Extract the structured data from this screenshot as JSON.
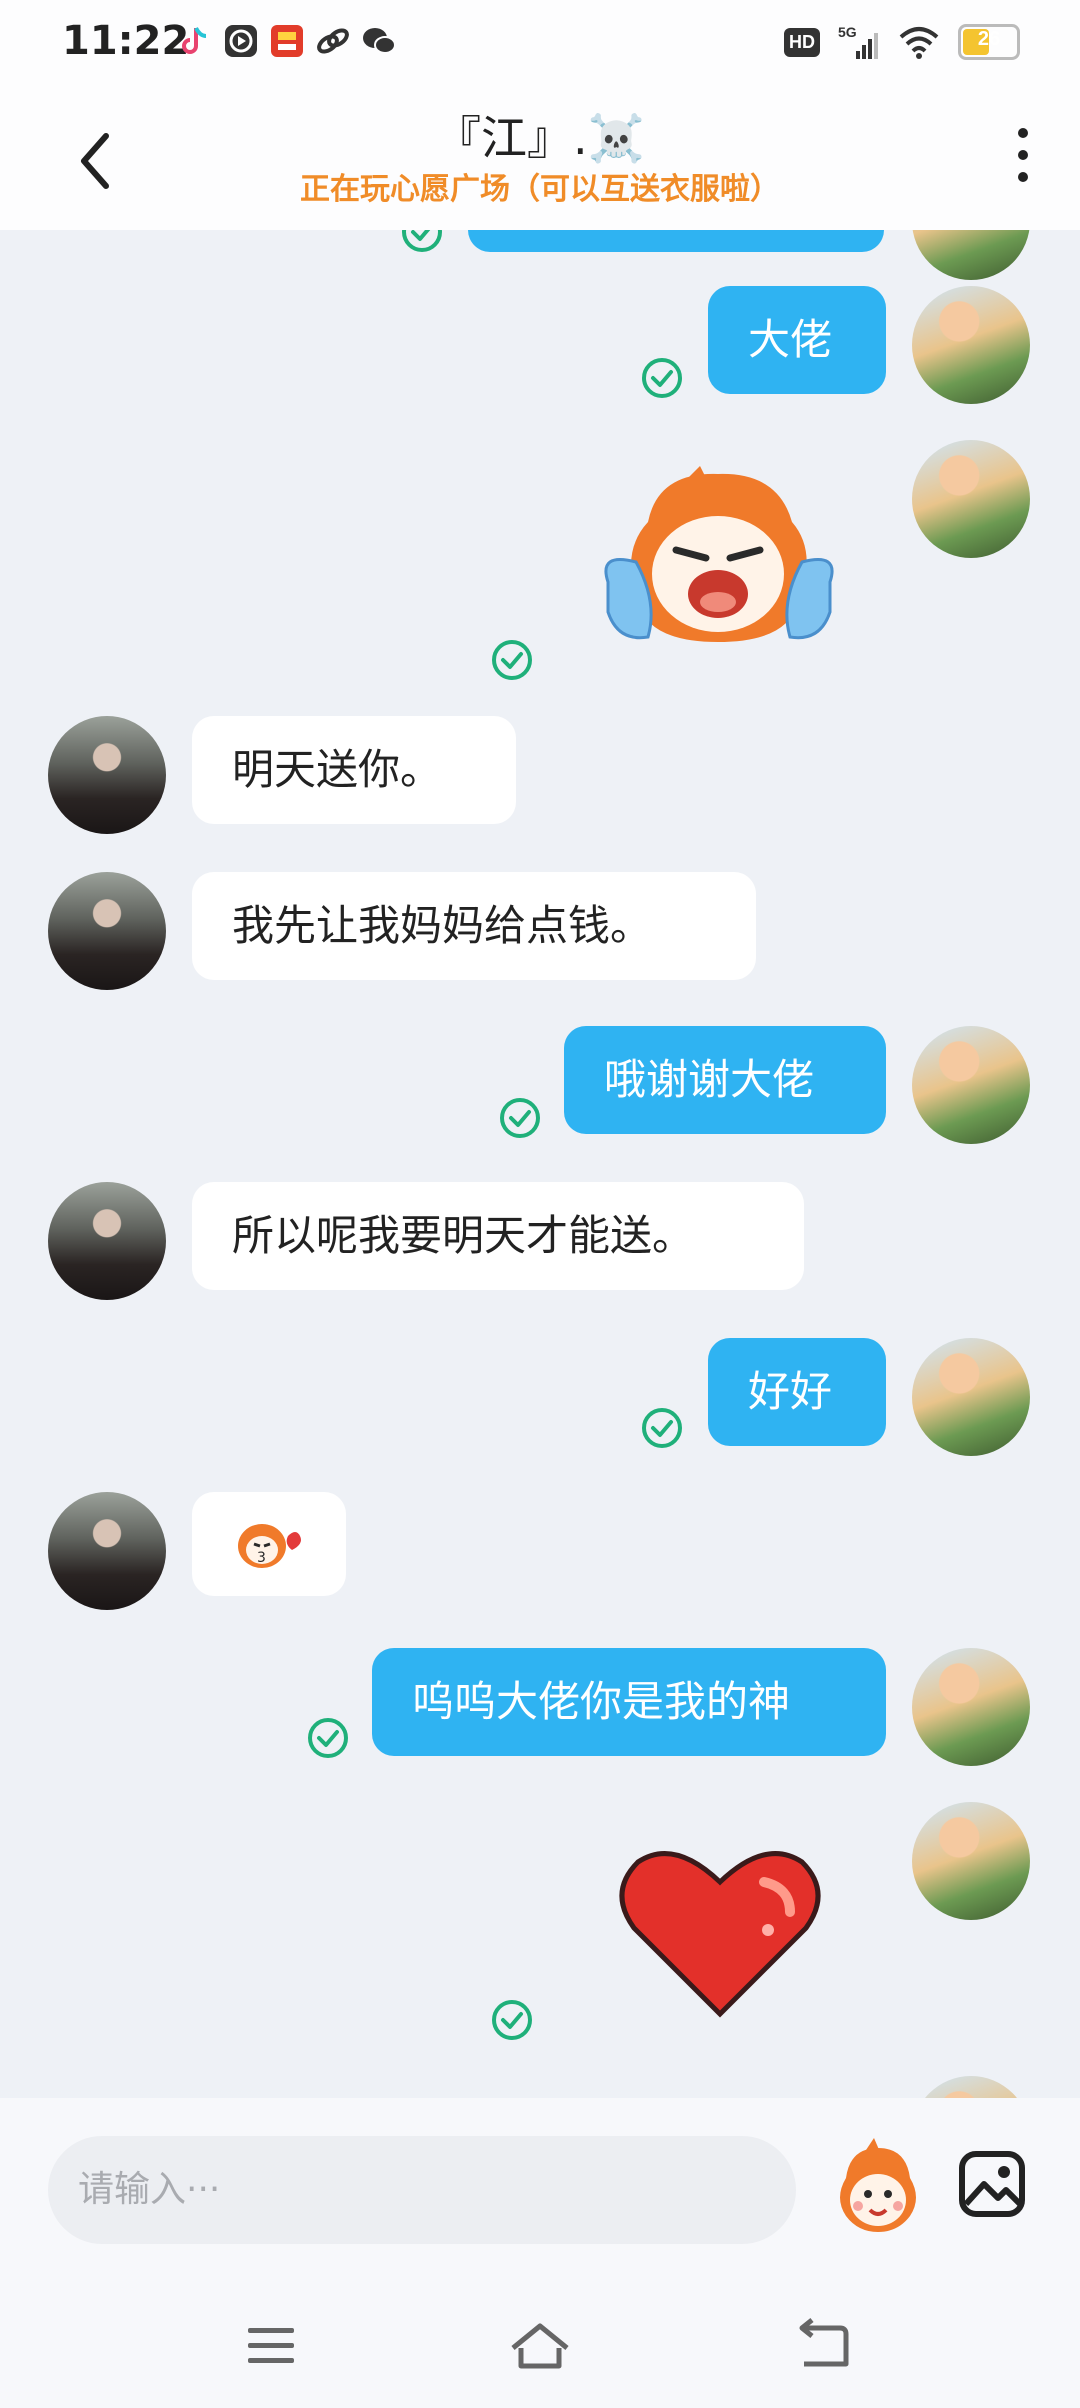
{
  "status_bar": {
    "time": "11:22",
    "hd": "HD",
    "network": "5G",
    "battery": "26",
    "battery_level": 0.26,
    "app_icons": [
      "tiktok-icon",
      "video-player-icon",
      "shopping-icon",
      "link-icon",
      "wechat-icon"
    ]
  },
  "header": {
    "title": "『江』.☠️",
    "subtitle": "正在玩心愿广场（可以互送衣服啦）"
  },
  "messages": [
    {
      "from": "me",
      "type": "text",
      "text": "大佬"
    },
    {
      "from": "me",
      "type": "sticker",
      "sticker": "crying-mascot-sticker"
    },
    {
      "from": "her",
      "type": "text",
      "text": "明天送你。"
    },
    {
      "from": "her",
      "type": "text",
      "text": "我先让我妈妈给点钱。"
    },
    {
      "from": "me",
      "type": "text",
      "text": "哦谢谢大佬"
    },
    {
      "from": "her",
      "type": "text",
      "text": "所以呢我要明天才能送。"
    },
    {
      "from": "me",
      "type": "text",
      "text": "好好"
    },
    {
      "from": "her",
      "type": "sticker",
      "sticker": "kiss-mascot-sticker"
    },
    {
      "from": "me",
      "type": "text",
      "text": "呜呜大佬你是我的神"
    },
    {
      "from": "me",
      "type": "sticker",
      "sticker": "heart-sticker"
    }
  ],
  "input": {
    "placeholder": "请输入···"
  },
  "colors": {
    "accent": "#2fb3f2",
    "subtitle": "#f08c28",
    "read_check": "#1fb07a",
    "background": "#eef1f6"
  }
}
